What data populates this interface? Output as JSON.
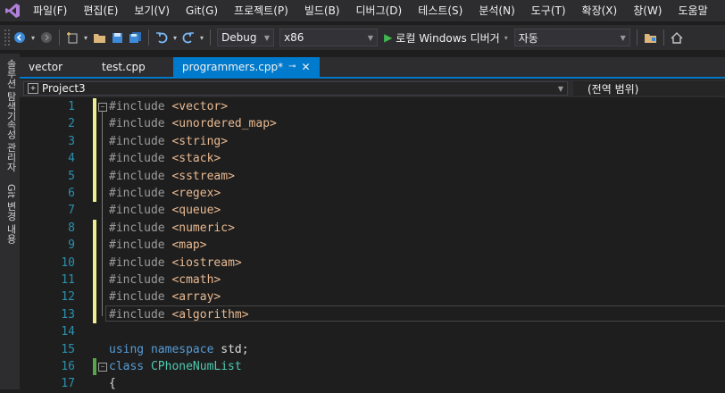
{
  "menubar": {
    "items": [
      "파일(F)",
      "편집(E)",
      "보기(V)",
      "Git(G)",
      "프로젝트(P)",
      "빌드(B)",
      "디버그(D)",
      "테스트(S)",
      "분석(N)",
      "도구(T)",
      "확장(X)",
      "창(W)",
      "도움말"
    ]
  },
  "toolbar": {
    "config": "Debug",
    "platform": "x86",
    "run_label": "로컬 Windows 디버거",
    "run_mode": "자동"
  },
  "side_rail": {
    "tabs": [
      "솔루션 탐색기",
      "속성 관리자",
      "Git 변경 내용"
    ]
  },
  "tabs": [
    {
      "label": "vector"
    },
    {
      "label": "test.cpp"
    },
    {
      "label": "programmers.cpp*"
    }
  ],
  "navbar": {
    "project": "Project3",
    "scope": "(전역 범위)"
  },
  "code": {
    "include_kw": "#include",
    "lines": [
      {
        "n": "1",
        "header": "<vector>"
      },
      {
        "n": "2",
        "header": "<unordered_map>"
      },
      {
        "n": "3",
        "header": "<string>"
      },
      {
        "n": "4",
        "header": "<stack>"
      },
      {
        "n": "5",
        "header": "<sstream>"
      },
      {
        "n": "6",
        "header": "<regex>"
      },
      {
        "n": "7",
        "header": "<queue>"
      },
      {
        "n": "8",
        "header": "<numeric>"
      },
      {
        "n": "9",
        "header": "<map>"
      },
      {
        "n": "10",
        "header": "<iostream>"
      },
      {
        "n": "11",
        "header": "<cmath>"
      },
      {
        "n": "12",
        "header": "<array>"
      },
      {
        "n": "13",
        "header": "<algorithm>"
      }
    ],
    "line14": "14",
    "line15": {
      "n": "15",
      "kw1": "using",
      "kw2": "namespace",
      "rest": "std;"
    },
    "line16": {
      "n": "16",
      "kw": "class",
      "name": "CPhoneNumList"
    },
    "line17": {
      "n": "17",
      "text": "{"
    }
  },
  "colors": {
    "accent": "#007acc",
    "changed": "#efef8f",
    "saved": "#57a64a",
    "keyword": "#569cd6",
    "header_string": "#e8b991",
    "type": "#4ec9b0",
    "line_number": "#2b91af"
  }
}
